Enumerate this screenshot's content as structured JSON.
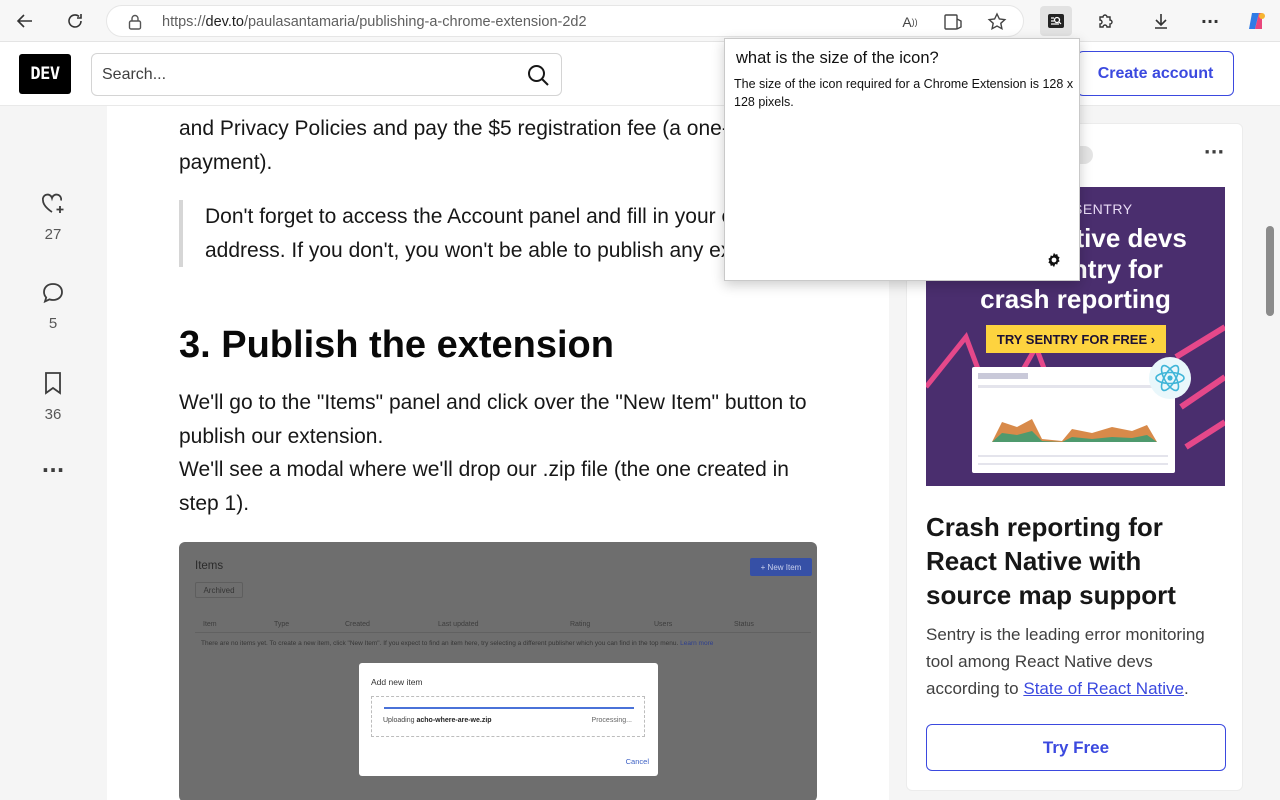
{
  "browser": {
    "url_prefix": "https://",
    "url_host": "dev.to",
    "url_path": "/paulasantamaria/publishing-a-chrome-extension-2d2",
    "read_aloud_glyph": "A"
  },
  "header": {
    "logo": "DEV",
    "search_placeholder": "Search...",
    "create_account": "Create account"
  },
  "reactions": {
    "likes": "27",
    "comments": "5",
    "bookmarks": "36"
  },
  "article": {
    "para_top_line1": "and Privacy Policies and pay the $5 registration fee (a one-time",
    "para_top_line2": "payment).",
    "quote": "Don't forget to access the Account panel and fill in your email address. If you don't, you won't be able to publish any extension.",
    "heading": "3. Publish the extension",
    "para_1": "We'll go to the \"Items\" panel and click over the \"New Item\" button to publish our extension.",
    "para_2": "We'll see a modal where we'll drop our .zip file (the one created in step 1)."
  },
  "embed": {
    "title": "Items",
    "new_item": "+ New Item",
    "archived": "Archived",
    "columns": [
      "Item",
      "Type",
      "Created",
      "Last updated",
      "Rating",
      "Users",
      "Status"
    ],
    "empty_text": "There are no items yet. To create a new item, click \"New Item\". If you expect to find an item here, try selecting a different publisher which you can find in the top menu.",
    "learn_more": "Learn more",
    "modal_title": "Add new item",
    "uploading_label": "Uploading",
    "uploading_file": "acho-where-are-we.zip",
    "processing": "Processing...",
    "cancel": "Cancel"
  },
  "ad": {
    "brand": "SENTRY",
    "headline_line1": "React Native devs",
    "headline_line2": "use Sentry for",
    "headline_line3": "crash reporting",
    "cta": "TRY SENTRY FOR FREE ›",
    "title": "Crash reporting for React Native with source map support",
    "body": "Sentry is the leading error monitoring tool among React Native devs according to",
    "body_link": "State of React Native",
    "body_end": ".",
    "try_free": "Try Free"
  },
  "extension_popup": {
    "question": "what is the size of the icon?",
    "answer": "The size of the icon required for a Chrome Extension is 128 x 128 pixels."
  },
  "colors": {
    "accent": "#3b49df",
    "ad_bg": "#4a2e6e",
    "ad_cta": "#fdd33f"
  }
}
